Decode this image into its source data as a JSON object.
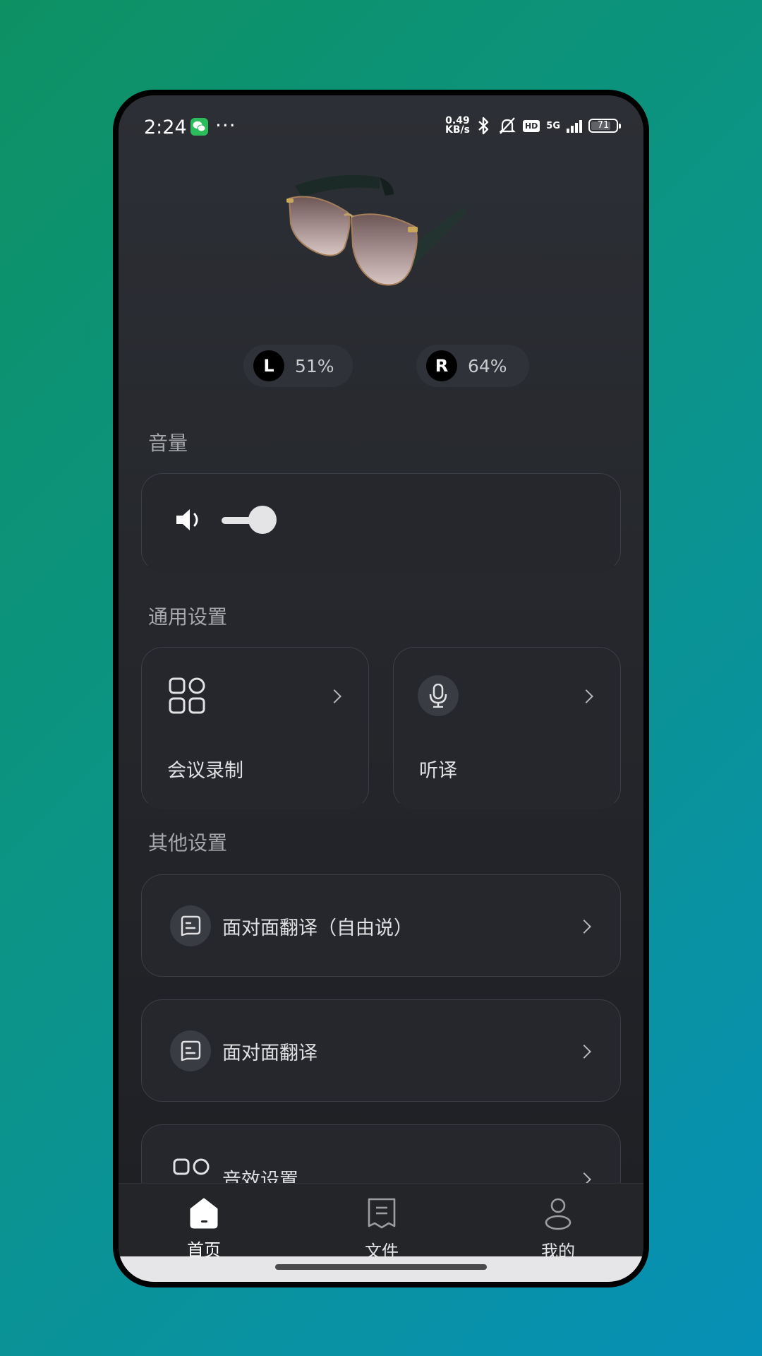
{
  "status_bar": {
    "time": "2:24",
    "speed_value": "0.49",
    "speed_unit": "KB/s",
    "hd": "HD",
    "network": "5G",
    "battery": "71"
  },
  "device": {
    "left_label": "L",
    "left_battery": "51%",
    "right_label": "R",
    "right_battery": "64%"
  },
  "volume": {
    "title": "音量",
    "level": 0.45
  },
  "general": {
    "title": "通用设置",
    "items": [
      {
        "label": "会议录制",
        "icon": "grid-icon"
      },
      {
        "label": "听译",
        "icon": "microphone-icon"
      }
    ]
  },
  "other": {
    "title": "其他设置",
    "items": [
      {
        "label": "面对面翻译（自由说）",
        "icon": "chat-icon"
      },
      {
        "label": "面对面翻译",
        "icon": "chat-icon"
      },
      {
        "label": "音效设置",
        "icon": "grid-icon"
      }
    ]
  },
  "nav": {
    "items": [
      {
        "label": "首页",
        "icon": "home-icon",
        "active": true
      },
      {
        "label": "文件",
        "icon": "document-icon",
        "active": false
      },
      {
        "label": "我的",
        "icon": "person-icon",
        "active": false
      }
    ]
  },
  "colors": {
    "background_start": "#0d9163",
    "background_end": "#0790b6",
    "screen_bg": "#25272c",
    "card_border": "#3c3e45",
    "accent_text": "#ffffff"
  }
}
